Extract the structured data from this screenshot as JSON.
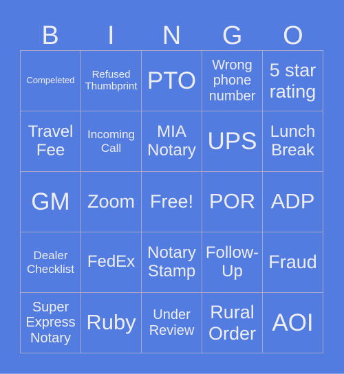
{
  "header": [
    "B",
    "I",
    "N",
    "G",
    "O"
  ],
  "cells": [
    {
      "text": "Compeleted",
      "size": "s12"
    },
    {
      "text": "Refused Thumbprint",
      "size": "s14"
    },
    {
      "text": "PTO",
      "size": "s34"
    },
    {
      "text": "Wrong phone number",
      "size": "s19"
    },
    {
      "text": "5 star rating",
      "size": "s26"
    },
    {
      "text": "Travel Fee",
      "size": "s22"
    },
    {
      "text": "Incoming Call",
      "size": "s16"
    },
    {
      "text": "MIA Notary",
      "size": "s22"
    },
    {
      "text": "UPS",
      "size": "s34"
    },
    {
      "text": "Lunch Break",
      "size": "s22"
    },
    {
      "text": "GM",
      "size": "s34"
    },
    {
      "text": "Zoom",
      "size": "s26"
    },
    {
      "text": "Free!",
      "size": "s26"
    },
    {
      "text": "POR",
      "size": "s30"
    },
    {
      "text": "ADP",
      "size": "s30"
    },
    {
      "text": "Dealer Checklist",
      "size": "s16"
    },
    {
      "text": "FedEx",
      "size": "s22"
    },
    {
      "text": "Notary Stamp",
      "size": "s22"
    },
    {
      "text": "Follow-Up",
      "size": "s22"
    },
    {
      "text": "Fraud",
      "size": "s26"
    },
    {
      "text": "Super Express Notary",
      "size": "s19"
    },
    {
      "text": "Ruby",
      "size": "s30"
    },
    {
      "text": "Under Review",
      "size": "s19"
    },
    {
      "text": "Rural Order",
      "size": "s26"
    },
    {
      "text": "AOI",
      "size": "s34"
    }
  ]
}
